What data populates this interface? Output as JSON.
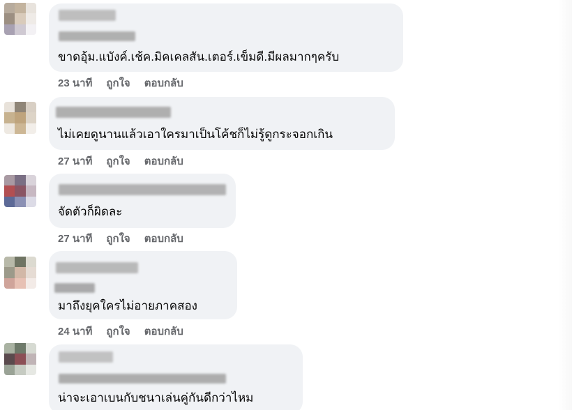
{
  "comments": [
    {
      "text": "ขาดอุ้ม.แบังค์.เช้ค.มิคเคลสัน.เตอร์.เข็มดี.มีผลมากๆครับ",
      "time": "23 นาที",
      "like": "ถูกใจ",
      "reply": "ตอบกลับ",
      "avatar_colors": [
        "#b7ab9d",
        "#c3b39e",
        "#e8e3dd",
        "#9c8f82",
        "#d9cbbb",
        "#efebe7",
        "#a8a1b2",
        "#cfc9d2",
        "#f3f1f4"
      ]
    },
    {
      "text": "ไม่เคยดูนานแล้วเอาใครมาเป็นโค้ชก็ไม่รู้ดูกระจอกเกิน",
      "time": "27 นาที",
      "like": "ถูกใจ",
      "reply": "ตอบกลับ",
      "avatar_colors": [
        "#e8e2da",
        "#8f8577",
        "#d8cfc4",
        "#c7b28f",
        "#bfa47d",
        "#ddd4c7",
        "#eee9e2",
        "#cdb795",
        "#f2eee9"
      ]
    },
    {
      "text": "จัดตัวก็ผิดละ",
      "time": "27 นาที",
      "like": "ถูกใจ",
      "reply": "ตอบกลับ",
      "avatar_colors": [
        "#a99aa3",
        "#7a6f84",
        "#d9d3da",
        "#b24f52",
        "#8a5564",
        "#c7b8c2",
        "#5d6a97",
        "#8b90b4",
        "#dcdbe6"
      ]
    },
    {
      "text": "มาถึงยุคใครไม่อายภาคสอง",
      "time": "24 นาที",
      "like": "ถูกใจ",
      "reply": "ตอบกลับ",
      "avatar_colors": [
        "#b8b9a9",
        "#6f7463",
        "#dcdad0",
        "#9c9a8a",
        "#d2b8a7",
        "#e6dcd4",
        "#cfa49a",
        "#e7c1b4",
        "#f3ebe7"
      ]
    },
    {
      "text": "น่าจะเอาเบนกับชนาเล่นคู่กันดีกว่าไหม",
      "time": "",
      "like": "",
      "reply": "",
      "avatar_colors": [
        "#a9b2a2",
        "#6e7a6a",
        "#d6dad2",
        "#5a4a4d",
        "#8c4f56",
        "#c0b4b6",
        "#9aa396",
        "#c6cbc2",
        "#e6e8e3"
      ]
    }
  ]
}
